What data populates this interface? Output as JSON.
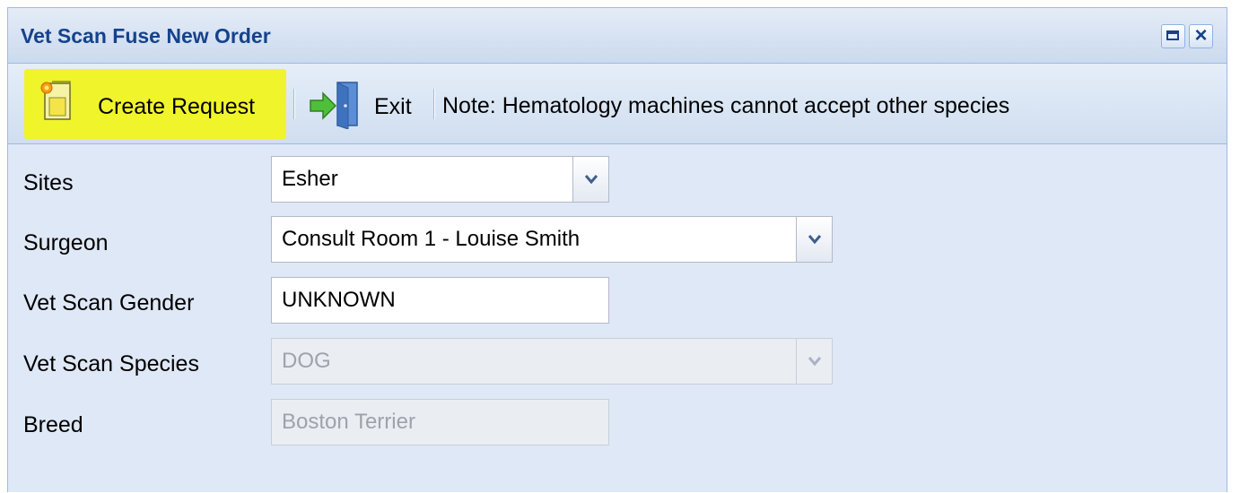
{
  "window": {
    "title": "Vet Scan Fuse New Order"
  },
  "toolbar": {
    "create_label": "Create Request",
    "exit_label": "Exit",
    "note": "Note: Hematology machines cannot accept other species"
  },
  "form": {
    "sites": {
      "label": "Sites",
      "value": "Esher"
    },
    "surgeon": {
      "label": "Surgeon",
      "value": "Consult Room 1 - Louise Smith"
    },
    "gender": {
      "label": "Vet Scan Gender",
      "value": "UNKNOWN"
    },
    "species": {
      "label": "Vet Scan Species",
      "value": "DOG"
    },
    "breed": {
      "label": "Breed",
      "value": "Boston Terrier"
    }
  },
  "colors": {
    "title_text": "#15428b",
    "panel_background": "#dfe8f6",
    "highlight": "#f0f42a",
    "border": "#99bbe8"
  },
  "icons": {
    "create": "new-document-icon",
    "exit": "exit-door-icon",
    "maximize": "maximize-icon",
    "close": "close-icon",
    "dropdown": "chevron-down-icon"
  }
}
